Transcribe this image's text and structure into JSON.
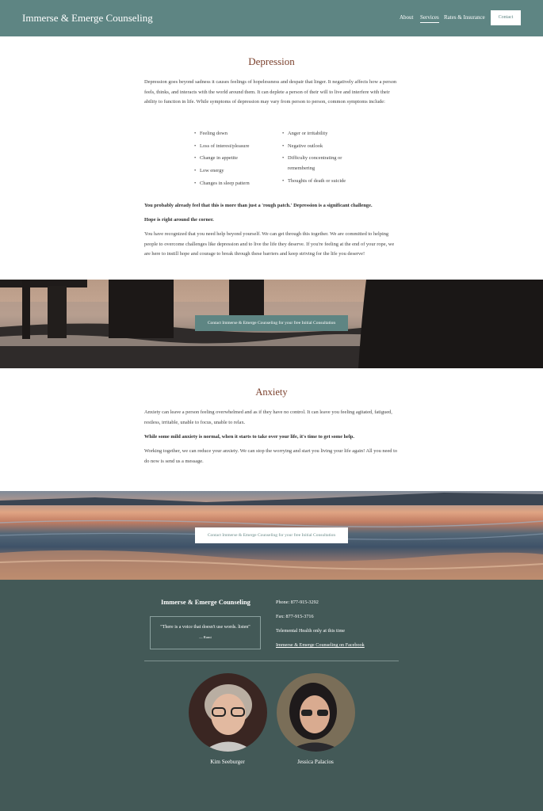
{
  "header": {
    "brand": "Immerse & Emerge Counseling",
    "nav": [
      "About",
      "Services",
      "Rates & Insurance"
    ],
    "contact_button": "Contact"
  },
  "depression": {
    "title": "Depression",
    "intro": "Depression goes beyond sadness it causes feelings of hopelessness and despair that linger. It negatively affects how a person feels, thinks, and interacts with the world around them. It can deplete a person of their will to live and interfere with their ability to function in life. While symptoms of depression may vary from person to person, common symptoms include:",
    "symptoms_left": [
      "Feeling down",
      "Loss of interest/pleasure",
      "Change in appetite",
      "Low energy",
      "Changes in sleep pattern"
    ],
    "symptoms_right": [
      "Anger or irritability",
      "Negative outlook",
      "Difficulty concentrating or remembering",
      "Thoughts of death or suicide"
    ],
    "bold1": "You probably already feel that this is more than just a 'rough patch.' Depression is a significant challenge.",
    "bold2": "Hope is right around the corner.",
    "body": "You have recognized that you need help beyond yourself. We can get through this together.  We are committed to helping people to overcome challenges like depression and to live the life they deserve. If you're feeling at the end of your rope, we are here to instill hope and courage to break through these barriers and keep striving for the life you deserve!"
  },
  "cta1": "Contact Immerse & Emerge Counseling for your free Initial Consultation",
  "anxiety": {
    "title": "Anxiety",
    "intro": "Anxiety can leave a person feeling overwhelmed and as if they have no control. It can leave you feeling agitated, fatigued, restless, irritable, unable to focus, unable to relax.",
    "bold": "While some mild anxiety is normal, when it starts to take over your life, it's time to get some help.",
    "body": "Working together, we can reduce your anxiety. We can stop the worrying and start you living your life again! All you need to do now is send us a message."
  },
  "cta2": "Contact Immerse & Emerge Counseling for your free Initial Consultation",
  "footer": {
    "title": "Immerse & Emerge Counseling",
    "quote": "\"There is a voice that doesn't use words. listen\"",
    "quote_attr": "— Rumi",
    "phone": "Phone:  877-915-3292",
    "fax": "Fax:  877-915-3716",
    "telemental": "Telemental Health only at this time",
    "facebook": "Immerse & Emerge Counseling on Facebook",
    "people": [
      "Kim Seeburger",
      "Jessica Palacios"
    ]
  },
  "colors": {
    "header": "#5e8583",
    "footer": "#435957",
    "title": "#7a3f2b"
  }
}
